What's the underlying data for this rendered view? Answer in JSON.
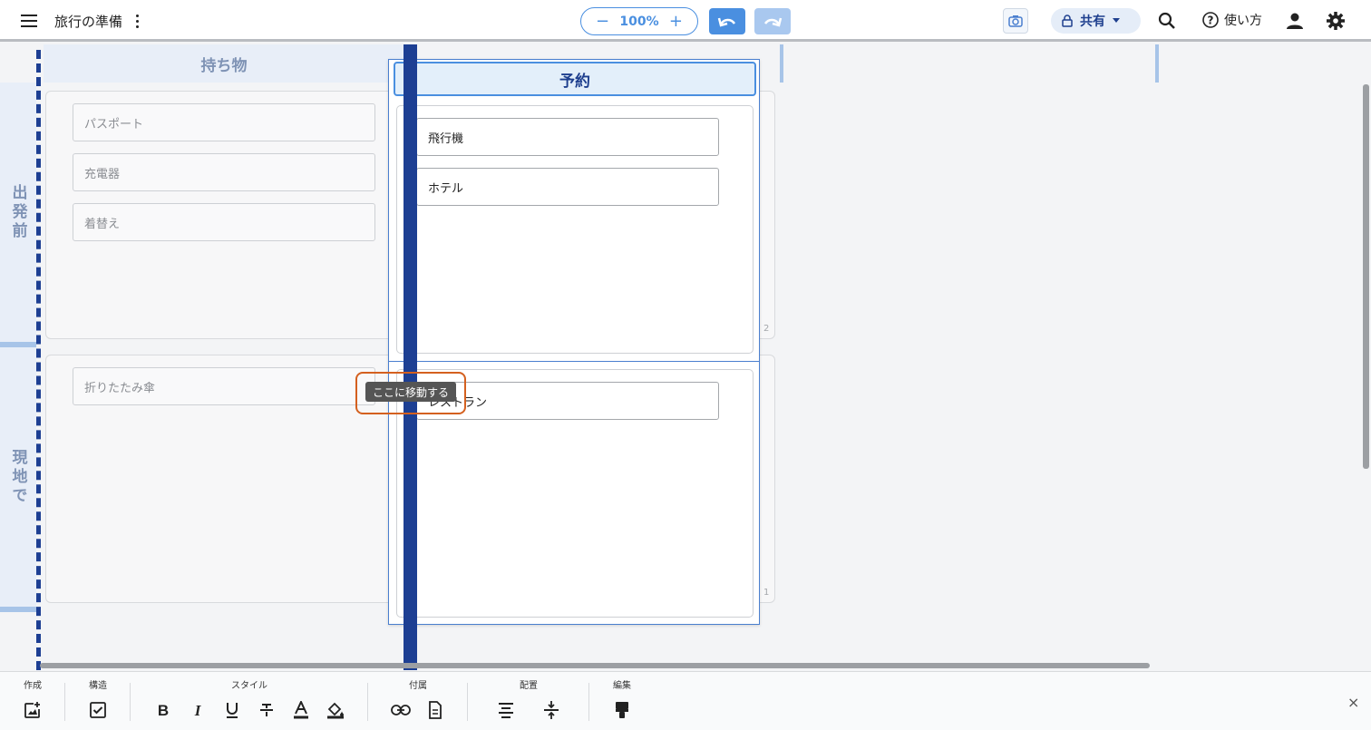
{
  "header": {
    "title": "旅行の準備",
    "zoom": "100%",
    "zoom_minus": "−",
    "zoom_plus": "+",
    "share_label": "共有",
    "help_label": "使い方"
  },
  "board": {
    "column_header": "持ち物",
    "rows": [
      {
        "label": "出発前"
      },
      {
        "label": "現地で"
      }
    ],
    "row1_cards": [
      "パスポート",
      "充電器",
      "着替え"
    ],
    "row2_cards": [
      "折りたたみ傘"
    ],
    "row1_count": "2",
    "row2_count": "1"
  },
  "panel": {
    "title": "予約",
    "top_cards": [
      "飛行機",
      "ホテル"
    ],
    "bottom_cards": [
      "レストラン"
    ]
  },
  "drag": {
    "tooltip": "ここに移動する"
  },
  "toolbar": {
    "groups": [
      "作成",
      "構造",
      "スタイル",
      "付属",
      "配置",
      "編集"
    ],
    "close": "×"
  },
  "colors": {
    "accent": "#4a8fe0",
    "dark_blue": "#1d3f93",
    "highlight": "#d4601f"
  }
}
